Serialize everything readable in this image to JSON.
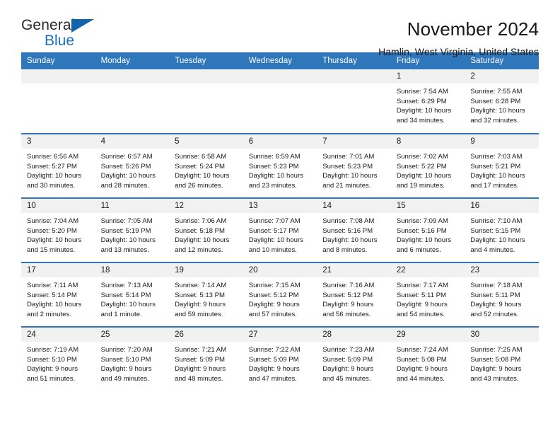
{
  "brand": {
    "name_part1": "General",
    "name_part2": "Blue",
    "accent_color": "#1b72c0"
  },
  "header": {
    "title": "November 2024",
    "subtitle": "Hamlin, West Virginia, United States"
  },
  "theme": {
    "header_blue": "#3076bb",
    "daynum_gray": "#f1f1f1"
  },
  "calendar": {
    "weekday_headers": [
      "Sunday",
      "Monday",
      "Tuesday",
      "Wednesday",
      "Thursday",
      "Friday",
      "Saturday"
    ],
    "weeks": [
      [
        {
          "day": "",
          "blank": true
        },
        {
          "day": "",
          "blank": true
        },
        {
          "day": "",
          "blank": true
        },
        {
          "day": "",
          "blank": true
        },
        {
          "day": "",
          "blank": true
        },
        {
          "day": "1",
          "sunrise": "Sunrise: 7:54 AM",
          "sunset": "Sunset: 6:29 PM",
          "daylight_line1": "Daylight: 10 hours",
          "daylight_line2": "and 34 minutes."
        },
        {
          "day": "2",
          "sunrise": "Sunrise: 7:55 AM",
          "sunset": "Sunset: 6:28 PM",
          "daylight_line1": "Daylight: 10 hours",
          "daylight_line2": "and 32 minutes."
        }
      ],
      [
        {
          "day": "3",
          "sunrise": "Sunrise: 6:56 AM",
          "sunset": "Sunset: 5:27 PM",
          "daylight_line1": "Daylight: 10 hours",
          "daylight_line2": "and 30 minutes."
        },
        {
          "day": "4",
          "sunrise": "Sunrise: 6:57 AM",
          "sunset": "Sunset: 5:26 PM",
          "daylight_line1": "Daylight: 10 hours",
          "daylight_line2": "and 28 minutes."
        },
        {
          "day": "5",
          "sunrise": "Sunrise: 6:58 AM",
          "sunset": "Sunset: 5:24 PM",
          "daylight_line1": "Daylight: 10 hours",
          "daylight_line2": "and 26 minutes."
        },
        {
          "day": "6",
          "sunrise": "Sunrise: 6:59 AM",
          "sunset": "Sunset: 5:23 PM",
          "daylight_line1": "Daylight: 10 hours",
          "daylight_line2": "and 23 minutes."
        },
        {
          "day": "7",
          "sunrise": "Sunrise: 7:01 AM",
          "sunset": "Sunset: 5:23 PM",
          "daylight_line1": "Daylight: 10 hours",
          "daylight_line2": "and 21 minutes."
        },
        {
          "day": "8",
          "sunrise": "Sunrise: 7:02 AM",
          "sunset": "Sunset: 5:22 PM",
          "daylight_line1": "Daylight: 10 hours",
          "daylight_line2": "and 19 minutes."
        },
        {
          "day": "9",
          "sunrise": "Sunrise: 7:03 AM",
          "sunset": "Sunset: 5:21 PM",
          "daylight_line1": "Daylight: 10 hours",
          "daylight_line2": "and 17 minutes."
        }
      ],
      [
        {
          "day": "10",
          "sunrise": "Sunrise: 7:04 AM",
          "sunset": "Sunset: 5:20 PM",
          "daylight_line1": "Daylight: 10 hours",
          "daylight_line2": "and 15 minutes."
        },
        {
          "day": "11",
          "sunrise": "Sunrise: 7:05 AM",
          "sunset": "Sunset: 5:19 PM",
          "daylight_line1": "Daylight: 10 hours",
          "daylight_line2": "and 13 minutes."
        },
        {
          "day": "12",
          "sunrise": "Sunrise: 7:06 AM",
          "sunset": "Sunset: 5:18 PM",
          "daylight_line1": "Daylight: 10 hours",
          "daylight_line2": "and 12 minutes."
        },
        {
          "day": "13",
          "sunrise": "Sunrise: 7:07 AM",
          "sunset": "Sunset: 5:17 PM",
          "daylight_line1": "Daylight: 10 hours",
          "daylight_line2": "and 10 minutes."
        },
        {
          "day": "14",
          "sunrise": "Sunrise: 7:08 AM",
          "sunset": "Sunset: 5:16 PM",
          "daylight_line1": "Daylight: 10 hours",
          "daylight_line2": "and 8 minutes."
        },
        {
          "day": "15",
          "sunrise": "Sunrise: 7:09 AM",
          "sunset": "Sunset: 5:16 PM",
          "daylight_line1": "Daylight: 10 hours",
          "daylight_line2": "and 6 minutes."
        },
        {
          "day": "16",
          "sunrise": "Sunrise: 7:10 AM",
          "sunset": "Sunset: 5:15 PM",
          "daylight_line1": "Daylight: 10 hours",
          "daylight_line2": "and 4 minutes."
        }
      ],
      [
        {
          "day": "17",
          "sunrise": "Sunrise: 7:11 AM",
          "sunset": "Sunset: 5:14 PM",
          "daylight_line1": "Daylight: 10 hours",
          "daylight_line2": "and 2 minutes."
        },
        {
          "day": "18",
          "sunrise": "Sunrise: 7:13 AM",
          "sunset": "Sunset: 5:14 PM",
          "daylight_line1": "Daylight: 10 hours",
          "daylight_line2": "and 1 minute."
        },
        {
          "day": "19",
          "sunrise": "Sunrise: 7:14 AM",
          "sunset": "Sunset: 5:13 PM",
          "daylight_line1": "Daylight: 9 hours",
          "daylight_line2": "and 59 minutes."
        },
        {
          "day": "20",
          "sunrise": "Sunrise: 7:15 AM",
          "sunset": "Sunset: 5:12 PM",
          "daylight_line1": "Daylight: 9 hours",
          "daylight_line2": "and 57 minutes."
        },
        {
          "day": "21",
          "sunrise": "Sunrise: 7:16 AM",
          "sunset": "Sunset: 5:12 PM",
          "daylight_line1": "Daylight: 9 hours",
          "daylight_line2": "and 56 minutes."
        },
        {
          "day": "22",
          "sunrise": "Sunrise: 7:17 AM",
          "sunset": "Sunset: 5:11 PM",
          "daylight_line1": "Daylight: 9 hours",
          "daylight_line2": "and 54 minutes."
        },
        {
          "day": "23",
          "sunrise": "Sunrise: 7:18 AM",
          "sunset": "Sunset: 5:11 PM",
          "daylight_line1": "Daylight: 9 hours",
          "daylight_line2": "and 52 minutes."
        }
      ],
      [
        {
          "day": "24",
          "sunrise": "Sunrise: 7:19 AM",
          "sunset": "Sunset: 5:10 PM",
          "daylight_line1": "Daylight: 9 hours",
          "daylight_line2": "and 51 minutes."
        },
        {
          "day": "25",
          "sunrise": "Sunrise: 7:20 AM",
          "sunset": "Sunset: 5:10 PM",
          "daylight_line1": "Daylight: 9 hours",
          "daylight_line2": "and 49 minutes."
        },
        {
          "day": "26",
          "sunrise": "Sunrise: 7:21 AM",
          "sunset": "Sunset: 5:09 PM",
          "daylight_line1": "Daylight: 9 hours",
          "daylight_line2": "and 48 minutes."
        },
        {
          "day": "27",
          "sunrise": "Sunrise: 7:22 AM",
          "sunset": "Sunset: 5:09 PM",
          "daylight_line1": "Daylight: 9 hours",
          "daylight_line2": "and 47 minutes."
        },
        {
          "day": "28",
          "sunrise": "Sunrise: 7:23 AM",
          "sunset": "Sunset: 5:09 PM",
          "daylight_line1": "Daylight: 9 hours",
          "daylight_line2": "and 45 minutes."
        },
        {
          "day": "29",
          "sunrise": "Sunrise: 7:24 AM",
          "sunset": "Sunset: 5:08 PM",
          "daylight_line1": "Daylight: 9 hours",
          "daylight_line2": "and 44 minutes."
        },
        {
          "day": "30",
          "sunrise": "Sunrise: 7:25 AM",
          "sunset": "Sunset: 5:08 PM",
          "daylight_line1": "Daylight: 9 hours",
          "daylight_line2": "and 43 minutes."
        }
      ]
    ]
  }
}
